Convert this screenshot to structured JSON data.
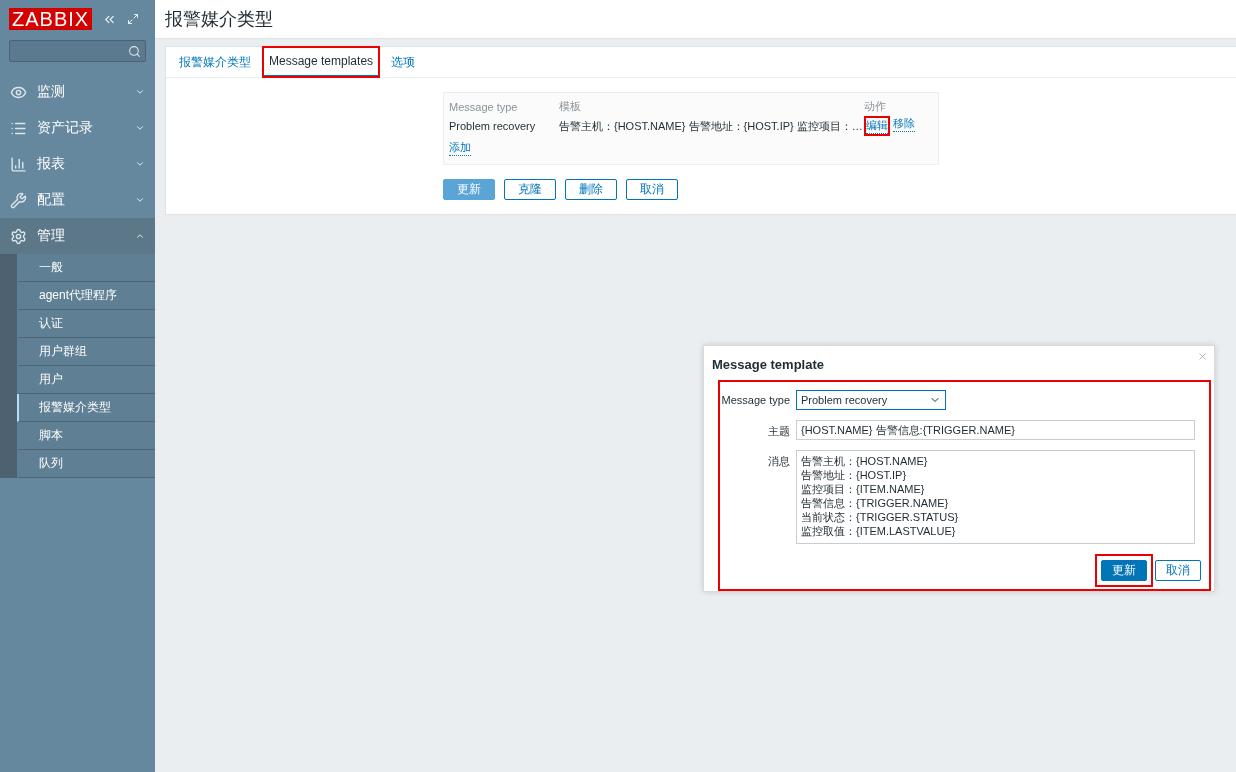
{
  "sidebar": {
    "logo": "ZABBIX",
    "menu": [
      {
        "label": "监测",
        "expanded": false
      },
      {
        "label": "资产记录",
        "expanded": false
      },
      {
        "label": "报表",
        "expanded": false
      },
      {
        "label": "配置",
        "expanded": false
      },
      {
        "label": "管理",
        "expanded": true,
        "children": [
          {
            "label": "一般",
            "selected": false
          },
          {
            "label": "agent代理程序",
            "selected": false
          },
          {
            "label": "认证",
            "selected": false
          },
          {
            "label": "用户群组",
            "selected": false
          },
          {
            "label": "用户",
            "selected": false
          },
          {
            "label": "报警媒介类型",
            "selected": true
          },
          {
            "label": "脚本",
            "selected": false
          },
          {
            "label": "队列",
            "selected": false
          }
        ]
      }
    ]
  },
  "header": {
    "title": "报警媒介类型"
  },
  "tabs": [
    {
      "label": "报警媒介类型",
      "selected": false,
      "highlighted": false
    },
    {
      "label": "Message templates",
      "selected": true,
      "highlighted": true
    },
    {
      "label": "选项",
      "selected": false,
      "highlighted": false
    }
  ],
  "templates_table": {
    "columns": [
      "Message type",
      "模板",
      "动作"
    ],
    "rows": [
      {
        "message_type": "Problem recovery",
        "template": "告警主机：{HOST.NAME} 告警地址：{HOST.IP} 监控项目：…",
        "actions": [
          {
            "label": "编辑",
            "highlighted": true
          },
          {
            "label": "移除",
            "highlighted": false
          }
        ]
      }
    ],
    "add_link": "添加"
  },
  "form_buttons": [
    {
      "label": "更新",
      "primary": true
    },
    {
      "label": "克隆",
      "primary": false
    },
    {
      "label": "删除",
      "primary": false
    },
    {
      "label": "取消",
      "primary": false
    }
  ],
  "dialog": {
    "title": "Message template",
    "highlighted": true,
    "fields": [
      {
        "kind": "select",
        "label": "Message type",
        "value": "Problem recovery"
      },
      {
        "kind": "text",
        "label": "主题",
        "value": "{HOST.NAME} 告警信息:{TRIGGER.NAME}"
      },
      {
        "kind": "textarea",
        "label": "消息",
        "value": "告警主机：{HOST.NAME}\n告警地址：{HOST.IP}\n监控项目：{ITEM.NAME}\n告警信息：{TRIGGER.NAME}\n当前状态：{TRIGGER.STATUS}\n监控取值：{ITEM.LASTVALUE}"
      }
    ],
    "buttons": [
      {
        "label": "更新",
        "primary": true,
        "highlighted": true
      },
      {
        "label": "取消",
        "primary": false,
        "highlighted": false
      }
    ]
  }
}
